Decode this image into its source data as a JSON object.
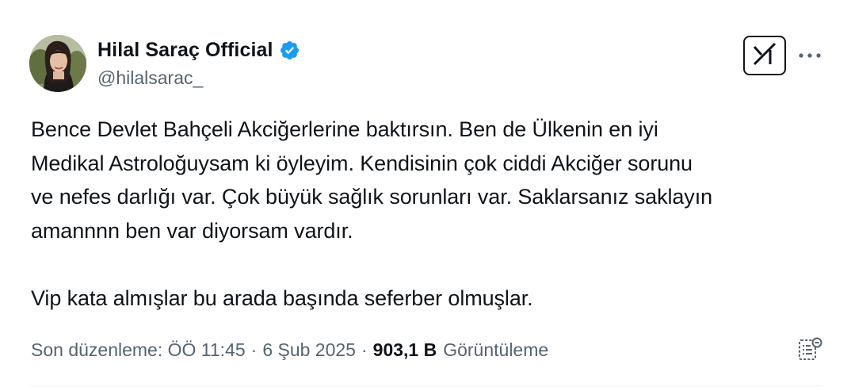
{
  "author": {
    "display_name": "Hilal Saraç Official",
    "handle": "@hilalsarac_",
    "verified": true,
    "verified_color": "#1d9bf0"
  },
  "actions": {
    "grok_icon": "grok-icon",
    "more_icon": "more-icon",
    "analytics_icon": "analytics-icon"
  },
  "tweet": {
    "lines": [
      "Bence Devlet Bahçeli Akciğerlerine baktırsın. Ben de Ülkenin en iyi",
      "Medikal Astroloğuysam ki öyleyim. Kendisinin çok ciddi Akciğer sorunu",
      "ve nefes darlığı var. Çok büyük sağlık sorunları var. Saklarsanız saklayın",
      "amannnn ben var diyorsam vardır."
    ],
    "second_paragraph": "Vip kata almışlar bu arada başında seferber olmuşlar."
  },
  "meta": {
    "edited_label": "Son düzenleme: ÖÖ 11:45",
    "separator": "·",
    "date": "6 Şub 2025",
    "views_count": "903,1 B",
    "views_label": "Görüntüleme"
  },
  "colors": {
    "text_primary": "#0f1419",
    "text_secondary": "#536471",
    "divider": "#eff3f4"
  }
}
